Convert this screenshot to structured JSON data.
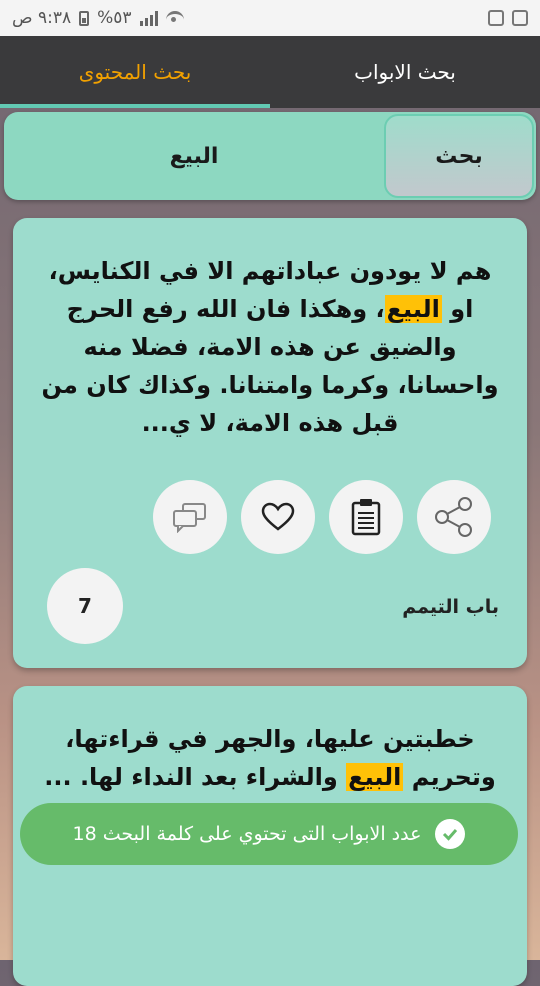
{
  "status_bar": {
    "time": "٩:٣٨ ص",
    "battery": "%٥٣"
  },
  "tabs": [
    {
      "label": "بحث الابواب",
      "active": false
    },
    {
      "label": "بحث المحتوى",
      "active": true
    }
  ],
  "search": {
    "value": "البيع",
    "button_label": "بحث"
  },
  "results": [
    {
      "text_before": "هم لا يودون عباداتهم الا في الكنايس، او ",
      "highlight": "البيع",
      "text_after": "، وهكذا فان الله رفع الحرج والضيق عن هذه الامة، فضلا منه واحسانا، وكرما وامتنانا. وكذاك كان من قبل هذه الامة، لا ي...",
      "chapter": "باب التيمم",
      "count": "7"
    },
    {
      "text_before": "خطبتين عليها، والجهر في قراءتها، وتحريم ",
      "highlight": "البيع",
      "text_after": " والشراء بعد النداء لها. ... لذا اجمع المسلمون انها فرض عين، ...",
      "chapter": "",
      "count": ""
    }
  ],
  "toast": {
    "message": "عدد الابواب التى تحتوي على كلمة البحث 18"
  },
  "colors": {
    "tab_bar": "#3a3a3c",
    "active_tab": "#f2a100",
    "card": "#9ddccd",
    "highlight": "#ffc107",
    "toast": "#66bb6a"
  }
}
